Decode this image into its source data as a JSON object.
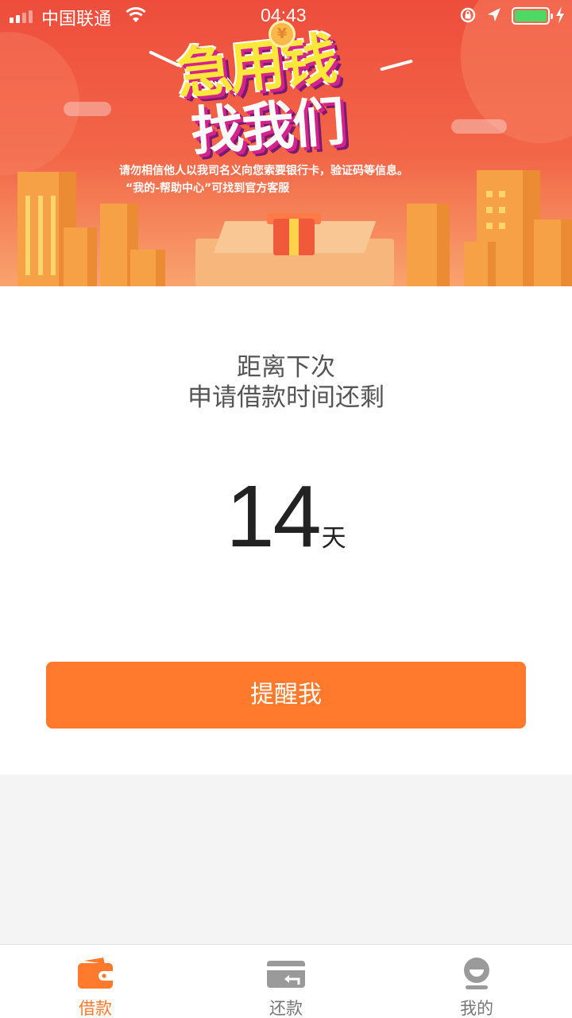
{
  "status_bar": {
    "carrier": "中国联通",
    "time": "04:43"
  },
  "banner": {
    "headline_line1": "急用钱",
    "headline_line2": "找我们",
    "notice_line1": "请勿相信他人以我司名义向您索要银行卡，验证码等信息。",
    "notice_line2": "“我的-帮助中心”可找到官方客服"
  },
  "main": {
    "label_line1": "距离下次",
    "label_line2": "申请借款时间还剩",
    "countdown_value": "14",
    "countdown_unit": "天",
    "remind_button": "提醒我"
  },
  "tabbar": {
    "tabs": [
      {
        "label": "借款",
        "icon": "wallet-icon",
        "active": true
      },
      {
        "label": "还款",
        "icon": "repay-card-icon",
        "active": false
      },
      {
        "label": "我的",
        "icon": "user-icon",
        "active": false
      }
    ]
  },
  "colors": {
    "accent": "#ff7a2d",
    "banner_red": "#ee4d3c",
    "battery_green": "#4cd964",
    "inactive_icon": "#9a9a9a"
  }
}
